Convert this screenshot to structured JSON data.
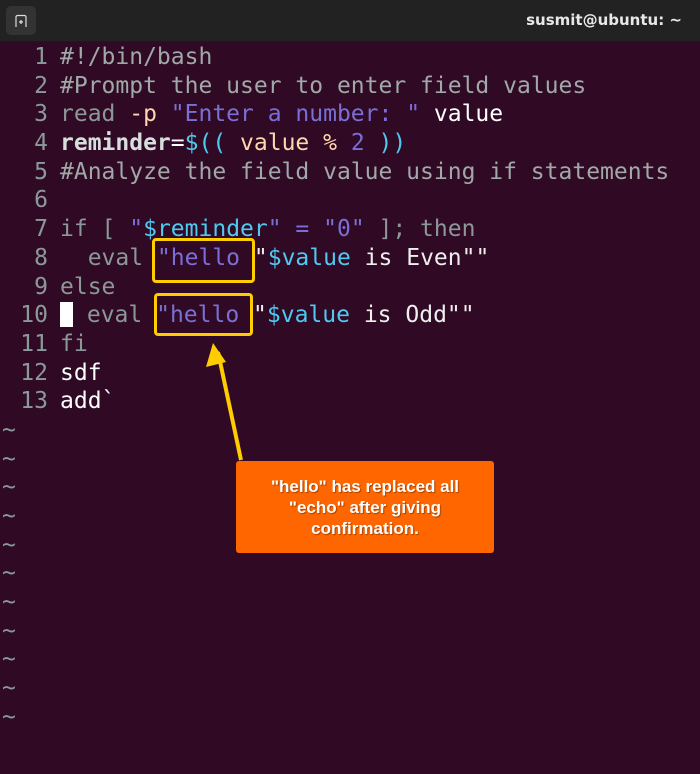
{
  "window": {
    "title": "susmit@ubuntu: ~",
    "new_tab_icon": "new-tab-icon"
  },
  "editor": {
    "lines": [
      {
        "n": "1",
        "segments": [
          {
            "t": "#!/bin/bash",
            "c": "c-comment"
          }
        ]
      },
      {
        "n": "2",
        "segments": [
          {
            "t": "#Prompt the user to enter field values",
            "c": "c-comment"
          }
        ]
      },
      {
        "n": "3",
        "segments": [
          {
            "t": "read ",
            "c": "c-kw"
          },
          {
            "t": "-p ",
            "c": "c-orange"
          },
          {
            "t": "\"Enter a number: \"",
            "c": "c-str"
          },
          {
            "t": " value",
            "c": "c-white"
          }
        ]
      },
      {
        "n": "4",
        "segments": [
          {
            "t": "reminder",
            "c": "c-bold"
          },
          {
            "t": "=",
            "c": "c-white"
          },
          {
            "t": "$((",
            "c": "c-var"
          },
          {
            "t": " value % ",
            "c": "c-orange"
          },
          {
            "t": "2",
            "c": "c-num"
          },
          {
            "t": " ))",
            "c": "c-var"
          }
        ]
      },
      {
        "n": "5",
        "segments": [
          {
            "t": "#Analyze the field value using if statements",
            "c": "c-comment"
          }
        ]
      },
      {
        "n": "6",
        "segments": []
      },
      {
        "n": "7",
        "segments": [
          {
            "t": "if [ ",
            "c": "c-kw"
          },
          {
            "t": "\"",
            "c": "c-str"
          },
          {
            "t": "$reminder",
            "c": "c-var"
          },
          {
            "t": "\" = \"0\"",
            "c": "c-str"
          },
          {
            "t": " ]; then",
            "c": "c-kw"
          }
        ]
      },
      {
        "n": "8",
        "segments": [
          {
            "t": "  eval ",
            "c": "c-kw"
          },
          {
            "t": "\"hello ",
            "c": "c-str"
          },
          {
            "t": "\"",
            "c": "c-plain"
          },
          {
            "t": "$value",
            "c": "c-var"
          },
          {
            "t": " is Even\"\"",
            "c": "c-plain"
          }
        ]
      },
      {
        "n": "9",
        "segments": [
          {
            "t": "else",
            "c": "c-kw"
          }
        ]
      },
      {
        "n": "10",
        "cursor": true,
        "segments": [
          {
            "t": " eval ",
            "c": "c-kw"
          },
          {
            "t": "\"hello ",
            "c": "c-str"
          },
          {
            "t": "\"",
            "c": "c-plain"
          },
          {
            "t": "$value",
            "c": "c-var"
          },
          {
            "t": " is Odd\"\"",
            "c": "c-plain"
          }
        ]
      },
      {
        "n": "11",
        "segments": [
          {
            "t": "fi",
            "c": "c-kw"
          }
        ]
      },
      {
        "n": "12",
        "segments": [
          {
            "t": "sdf",
            "c": "c-white"
          }
        ]
      },
      {
        "n": "13",
        "segments": [
          {
            "t": "add`",
            "c": "c-white"
          }
        ]
      }
    ],
    "empty_line_marker": "~",
    "empty_line_count": 11
  },
  "annotation": {
    "callout_text": "\"hello\" has replaced all \"echo\" after giving confirmation.",
    "highlight_color": "#ffcc00",
    "callout_color": "#ff6600"
  }
}
